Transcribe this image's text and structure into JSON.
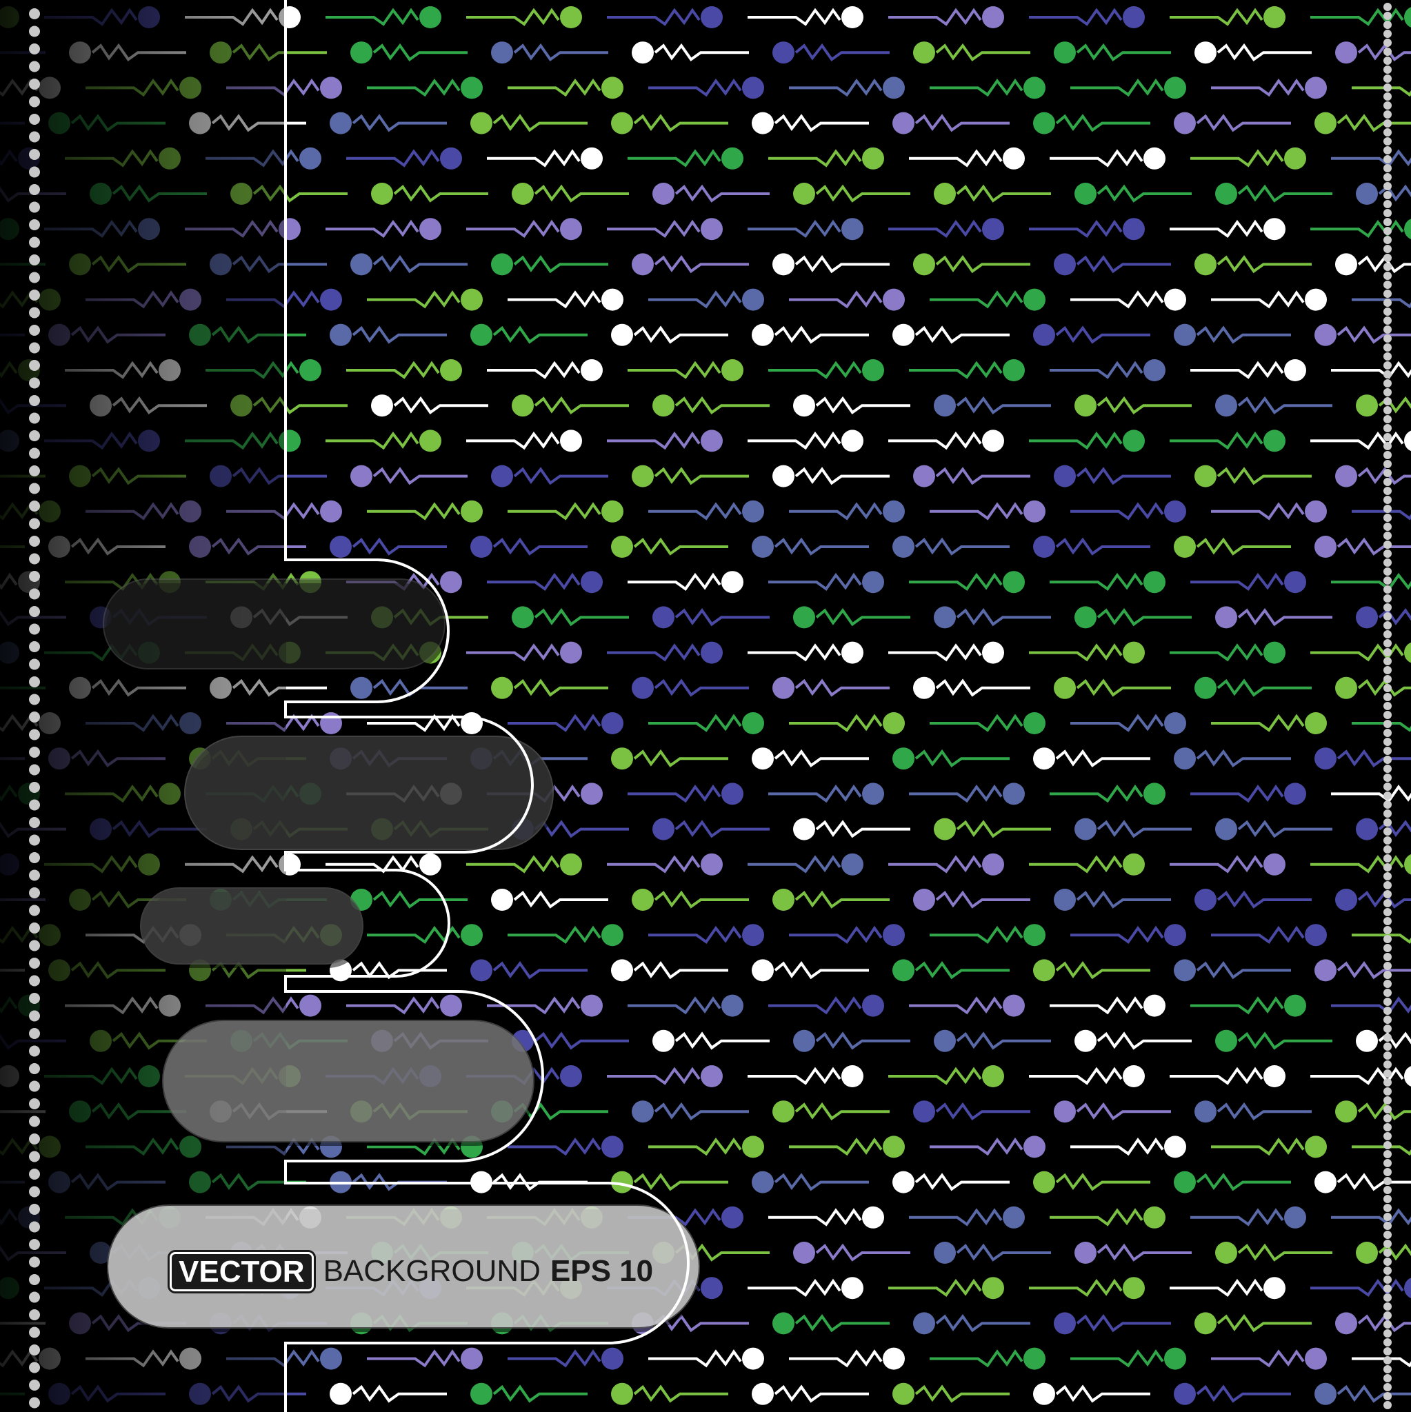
{
  "banner": {
    "badge": "VECTOR",
    "word": "BACKGROUND",
    "suffix": "EPS 10"
  },
  "colors": {
    "background": "#000000",
    "pattern": [
      "#ffffff",
      "#30a84a",
      "#7cc242",
      "#4a4aa6",
      "#5a6aa8",
      "#8a7ac8"
    ],
    "outline": "#ffffff",
    "dots_left": "#c8c8c8"
  },
  "pattern": {
    "motif": "line-zigzag-circle",
    "orientation": "alternating left/right per row"
  }
}
